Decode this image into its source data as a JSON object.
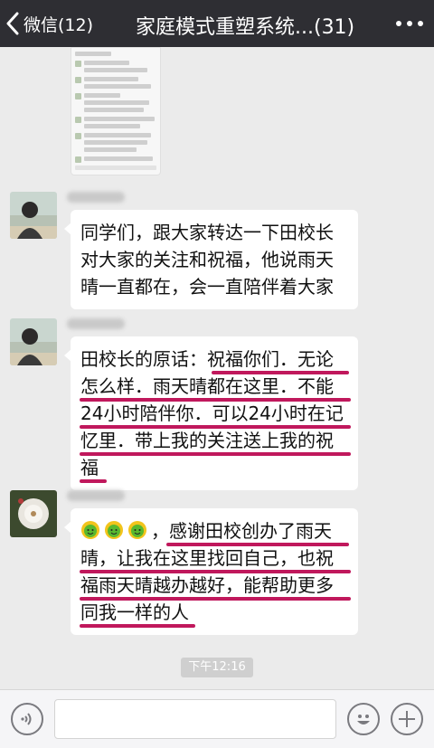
{
  "header": {
    "back_label": "微信(12)",
    "title": "家庭模式重塑系统...(31)"
  },
  "messages": [
    {
      "text": "同学们，跟大家转达一下田校长\n对大家的关注和祝福，他说雨天\n晴一直都在，会一直陪伴着大家"
    },
    {
      "text": "田校长的原话：祝福你们．无论\n怎么样．雨天晴都在这里．不能\n24小时陪伴你．可以24小时在记\n忆里．带上我的关注送上我的祝\n福"
    },
    {
      "emoji_icon": "smiling-green-face-emoji",
      "text_after_emoji": "，感谢田校创办了雨天",
      "text": "晴，让我在这里找回自己，也祝\n福雨天晴越办越好，能帮助更多\n同我一样的人"
    }
  ],
  "timestamp": "下午12:16",
  "colors": {
    "topbar": "#2e2e33",
    "background": "#ebebeb",
    "underline": "#c0185c"
  }
}
